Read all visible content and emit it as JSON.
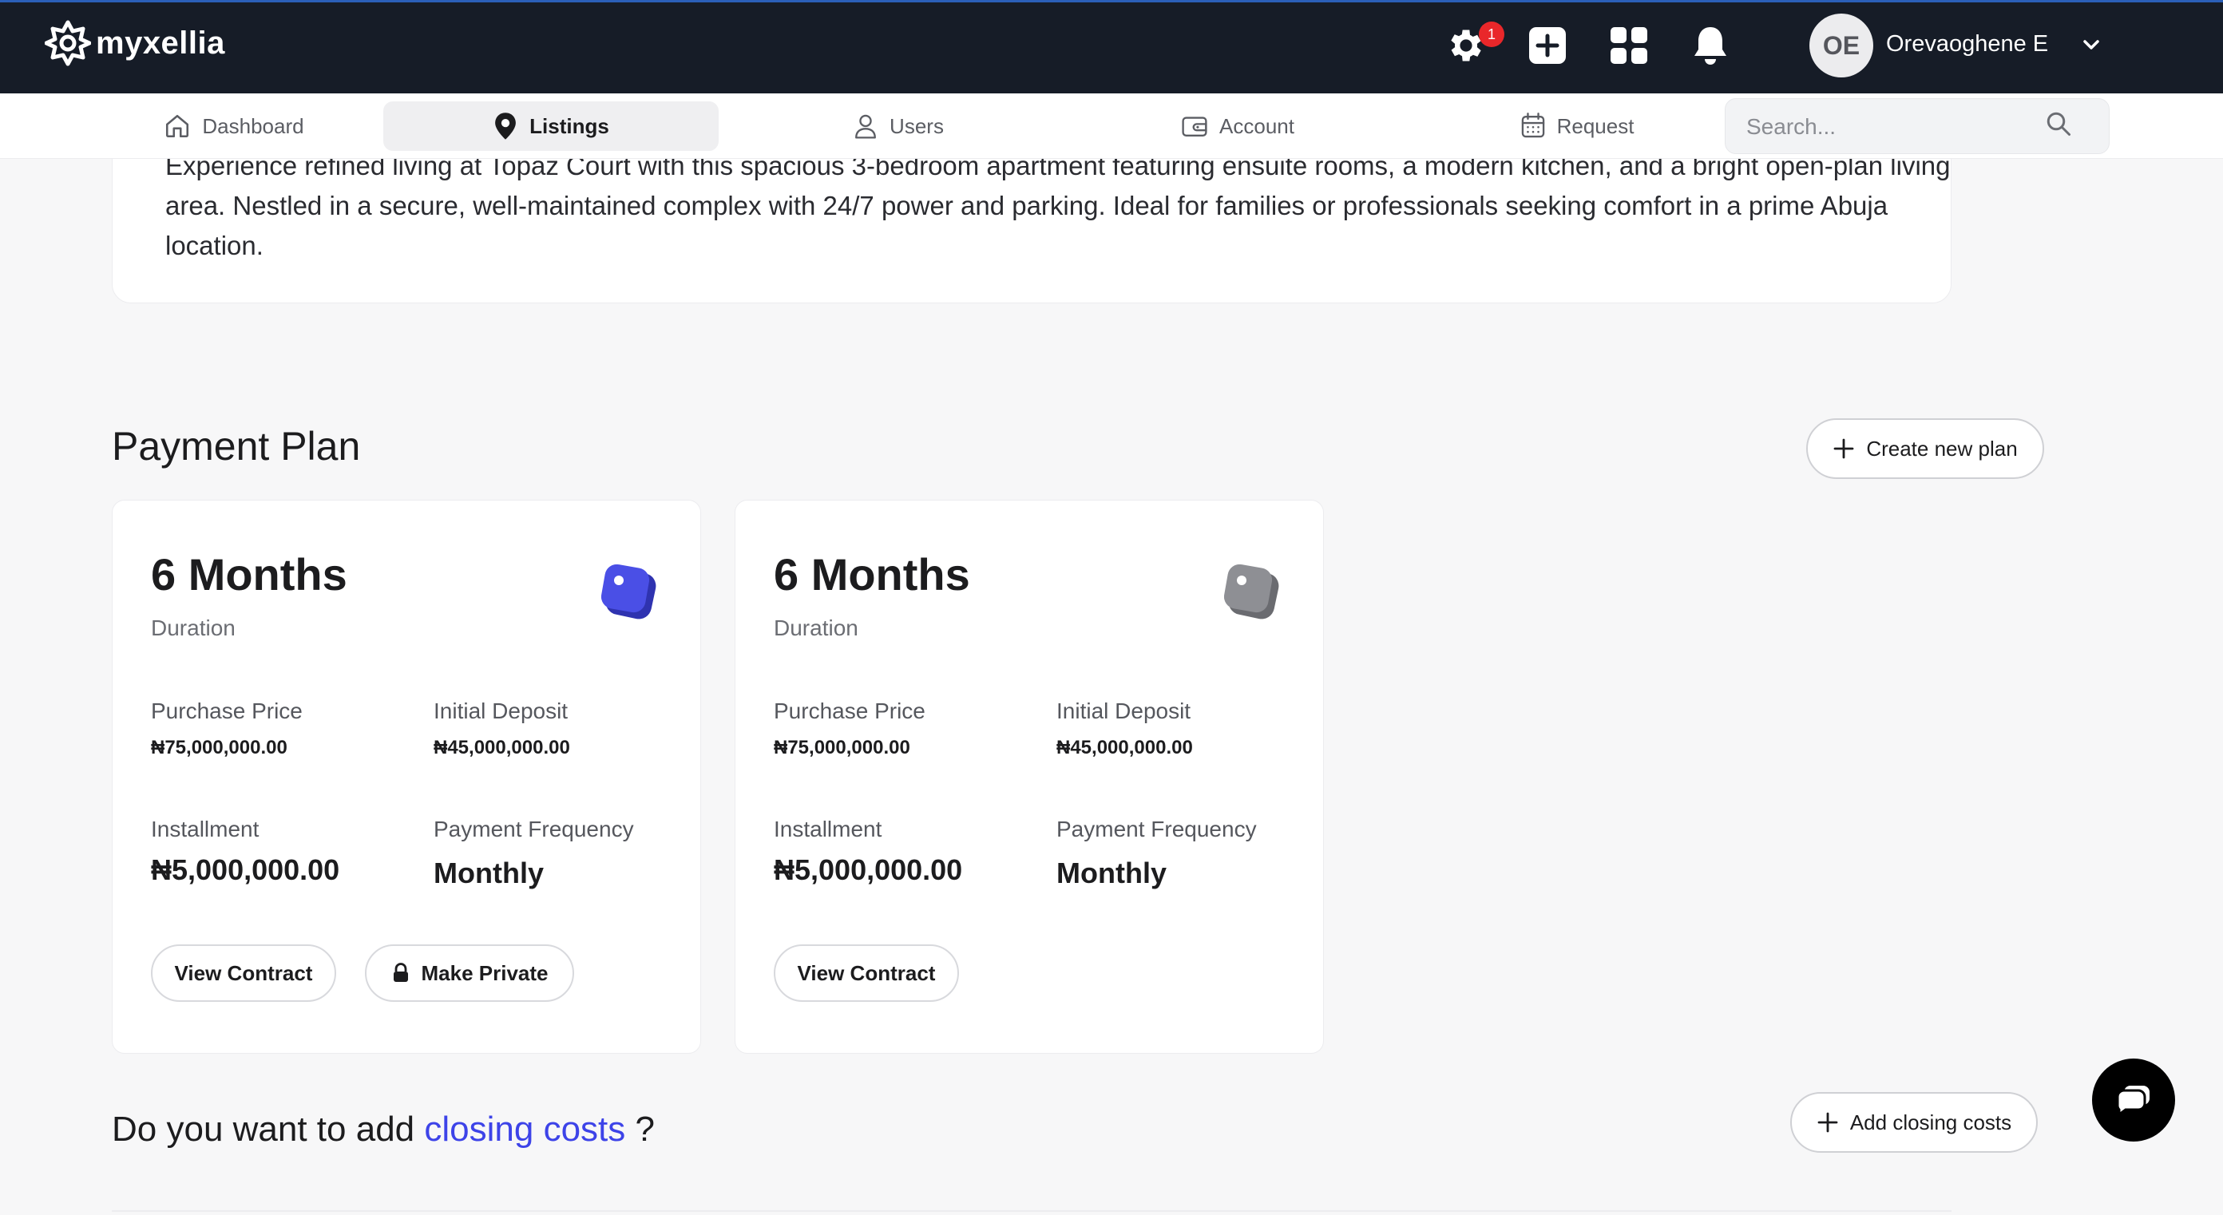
{
  "app": {
    "logo_text": "myxellia"
  },
  "topbar": {
    "settings_badge": "1",
    "avatar_initials": "OE",
    "user_name": "Orevaoghene E"
  },
  "nav": {
    "items": [
      {
        "label": "Dashboard",
        "icon": "home-icon"
      },
      {
        "label": "Listings",
        "icon": "location-pin-icon",
        "active": true
      },
      {
        "label": "Users",
        "icon": "user-icon"
      },
      {
        "label": "Account",
        "icon": "wallet-icon"
      },
      {
        "label": "Request",
        "icon": "calendar-icon"
      }
    ],
    "search_placeholder": "Search..."
  },
  "description": {
    "text": "Experience refined living at Topaz Court with this spacious 3-bedroom apartment featuring ensuite rooms, a modern kitchen, and a bright open-plan living area. Nestled in a secure, well-maintained complex with 24/7 power and parking. Ideal for families or professionals seeking comfort in a prime Abuja location."
  },
  "payment_plan": {
    "title": "Payment Plan",
    "create_button": "Create new plan",
    "labels": {
      "duration": "Duration",
      "purchase_price": "Purchase Price",
      "initial_deposit": "Initial Deposit",
      "installment": "Installment",
      "payment_frequency": "Payment Frequency",
      "view_contract": "View Contract",
      "make_private": "Make Private"
    },
    "plans": [
      {
        "months": "6 Months",
        "purchase_price": "₦75,000,000.00",
        "initial_deposit": "₦45,000,000.00",
        "installment": "₦5,000,000.00",
        "payment_frequency": "Monthly",
        "toggle_color": "#4a4fe6"
      },
      {
        "months": "6 Months",
        "purchase_price": "₦75,000,000.00",
        "initial_deposit": "₦45,000,000.00",
        "installment": "₦5,000,000.00",
        "payment_frequency": "Monthly",
        "toggle_color": "#8e8f94"
      }
    ]
  },
  "closing_costs": {
    "question_prefix": "Do you want to add",
    "question_link": "closing costs",
    "question_suffix": "?",
    "add_button": "Add closing costs"
  },
  "colors": {
    "topbar_bg": "#161c27",
    "accent": "#3d43e8",
    "badge": "#e9272a"
  }
}
